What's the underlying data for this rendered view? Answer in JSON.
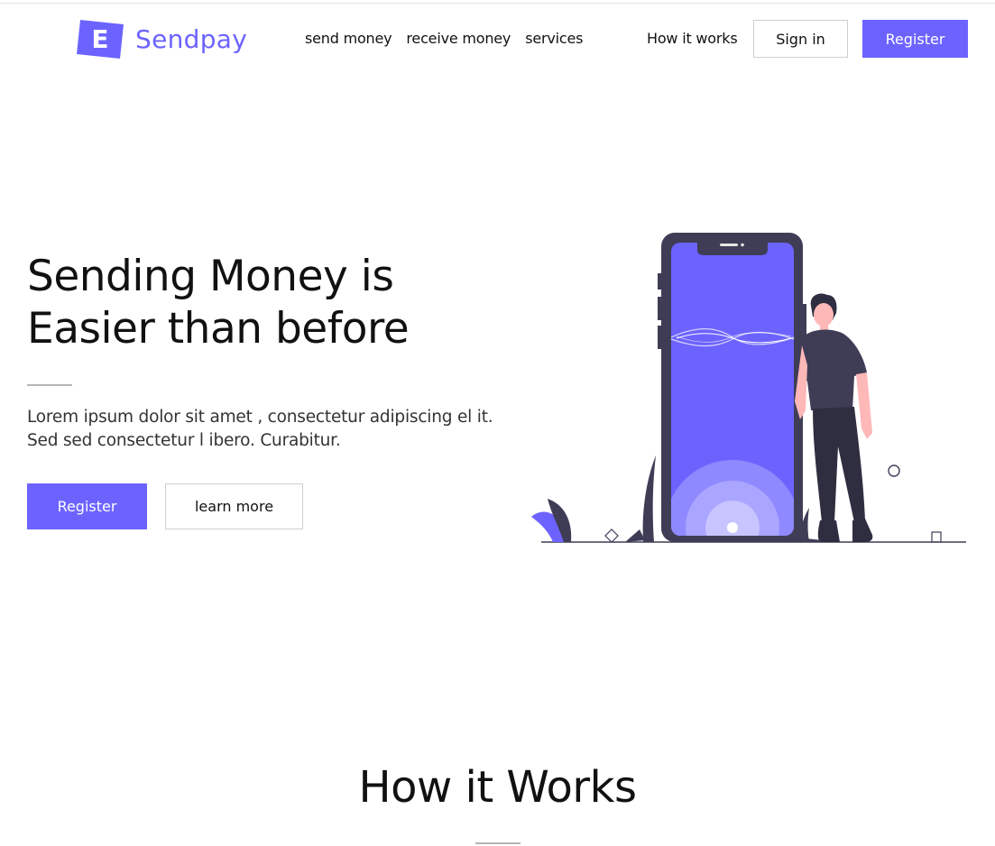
{
  "brand": {
    "logo_letter": "E",
    "name": "Sendpay",
    "accent": "#6c63ff"
  },
  "nav": {
    "items": [
      {
        "label": "send money"
      },
      {
        "label": "receive money"
      },
      {
        "label": "services"
      }
    ],
    "how_it_works": "How it works",
    "sign_in": "Sign in",
    "register": "Register"
  },
  "hero": {
    "title_line1": "Sending Money is",
    "title_line2": "Easier than before",
    "text": "Lorem ipsum dolor sit amet , consectetur adipiscing el it. Sed sed consectetur l ibero. Curabitur.",
    "register": "Register",
    "learn_more": "learn more"
  },
  "section": {
    "title": "How it Works"
  }
}
